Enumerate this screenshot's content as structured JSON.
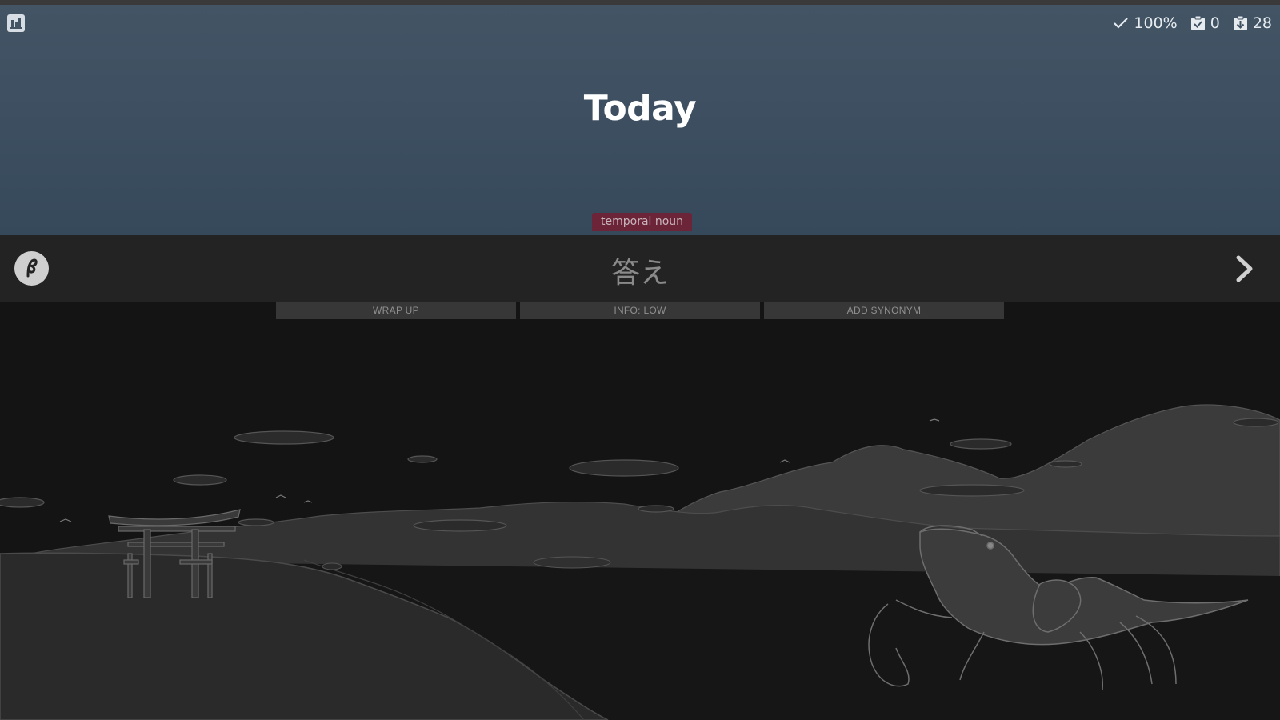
{
  "header": {
    "stats_icon": "bar-chart-icon",
    "counters": {
      "accuracy": "100%",
      "completed": "0",
      "remaining": "28"
    },
    "question": "Today",
    "part_of_speech": "temporal noun"
  },
  "answer": {
    "kana_icon": "kana-input-icon",
    "value": "答え",
    "submit_icon": "chevron-right-icon"
  },
  "actions": {
    "wrap_up": "WRAP UP",
    "info": "INFO: LOW",
    "add_synonym": "ADD SYNONYM"
  },
  "colors": {
    "header_top": "#435465",
    "header_bottom": "#36495b",
    "badge": "#6b2438",
    "answer_row": "#232323",
    "action_button": "#373737"
  }
}
